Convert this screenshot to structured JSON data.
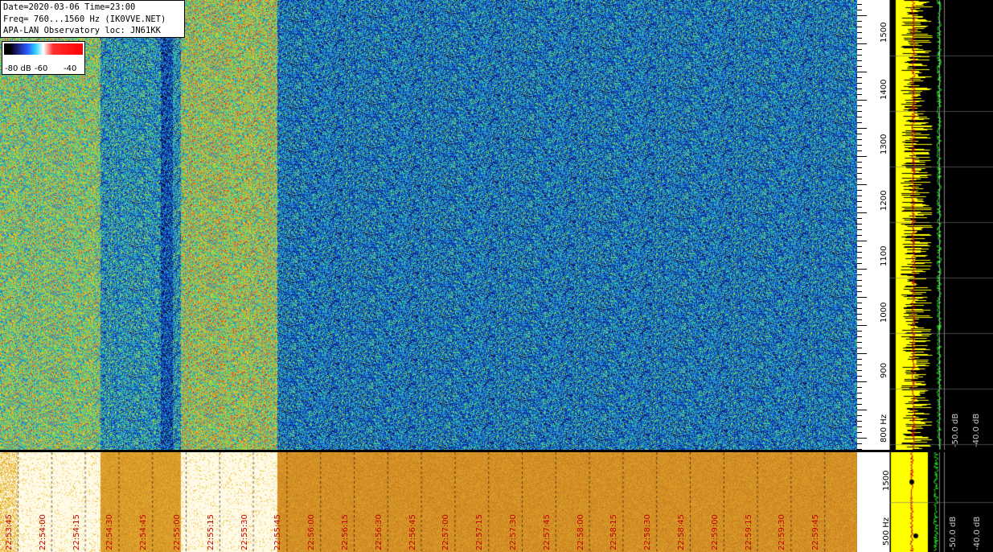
{
  "header": {
    "line1": "Date=2020-03-06 Time=23:00",
    "line2": "Freq= 760...1560 Hz (IK0VVE.NET)",
    "line3": "APA-LAN Observatory loc: JN61KK"
  },
  "legend": {
    "label_min": "-80 dB",
    "label_mid": "-60",
    "label_max": "-40"
  },
  "freq_axis": {
    "ticks": [
      "1500",
      "1400",
      "1300",
      "1200",
      "1100",
      "1000",
      "900",
      "800 Hz"
    ]
  },
  "freq_axis_lower": {
    "ticks": [
      "1500",
      "500 Hz"
    ]
  },
  "spectrum_panel": {
    "db_labels": [
      "-50.0 dB",
      "-40.0 dB"
    ]
  },
  "spectrum_panel_lower": {
    "db_labels": [
      "-50.0 dB",
      "-40.0 dB"
    ]
  },
  "time_axis": {
    "labels": [
      "22:53:45",
      "22:54:00",
      "22:54:15",
      "22:54:30",
      "22:54:45",
      "22:55:00",
      "22:55:15",
      "22:55:30",
      "22:55:45",
      "22:56:00",
      "22:56:15",
      "22:56:30",
      "22:56:45",
      "22:57:00",
      "22:57:15",
      "22:57:30",
      "22:57:45",
      "22:58:00",
      "22:58:15",
      "22:58:30",
      "22:58:45",
      "22:59:00",
      "22:59:15",
      "22:59:30",
      "22:59:45"
    ]
  },
  "colors": {
    "spectrogram_background": "#1e6fd0",
    "spectrum_trace": "#ffff00",
    "avg_trace": "#00cc00",
    "time_label": "#c00000"
  }
}
